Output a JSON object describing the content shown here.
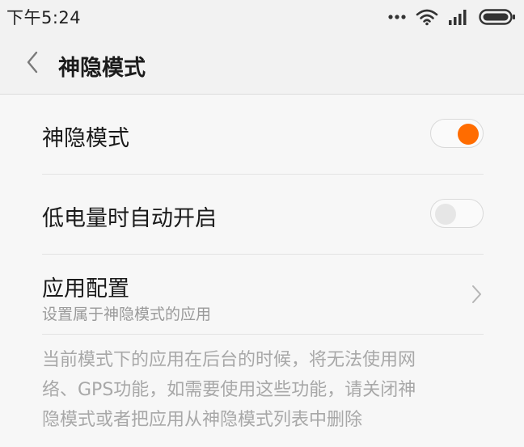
{
  "status_bar": {
    "time": "下午5:24",
    "icons": [
      "more-dots-icon",
      "wifi-icon",
      "signal-icon",
      "battery-icon"
    ]
  },
  "header": {
    "back_icon": "chevron-left-icon",
    "title": "神隐模式"
  },
  "settings": {
    "items": [
      {
        "label": "神隐模式",
        "type": "toggle",
        "enabled": true
      },
      {
        "label": "低电量时自动开启",
        "type": "toggle",
        "enabled": false
      },
      {
        "label": "应用配置",
        "sublabel": "设置属于神隐模式的应用",
        "type": "link",
        "icon": "chevron-right-icon"
      }
    ],
    "note_lines": [
      "当前模式下的应用在后台的时候，将无法使用网",
      "络、GPS功能，如需要使用这些功能，请关闭神",
      "隐模式或者把应用从神隐模式列表中删除"
    ]
  },
  "colors": {
    "accent": "#ff6c00",
    "background": "#f7f7f7",
    "bar_background": "#f2f2f2",
    "secondary_text": "#9a9a9a"
  }
}
